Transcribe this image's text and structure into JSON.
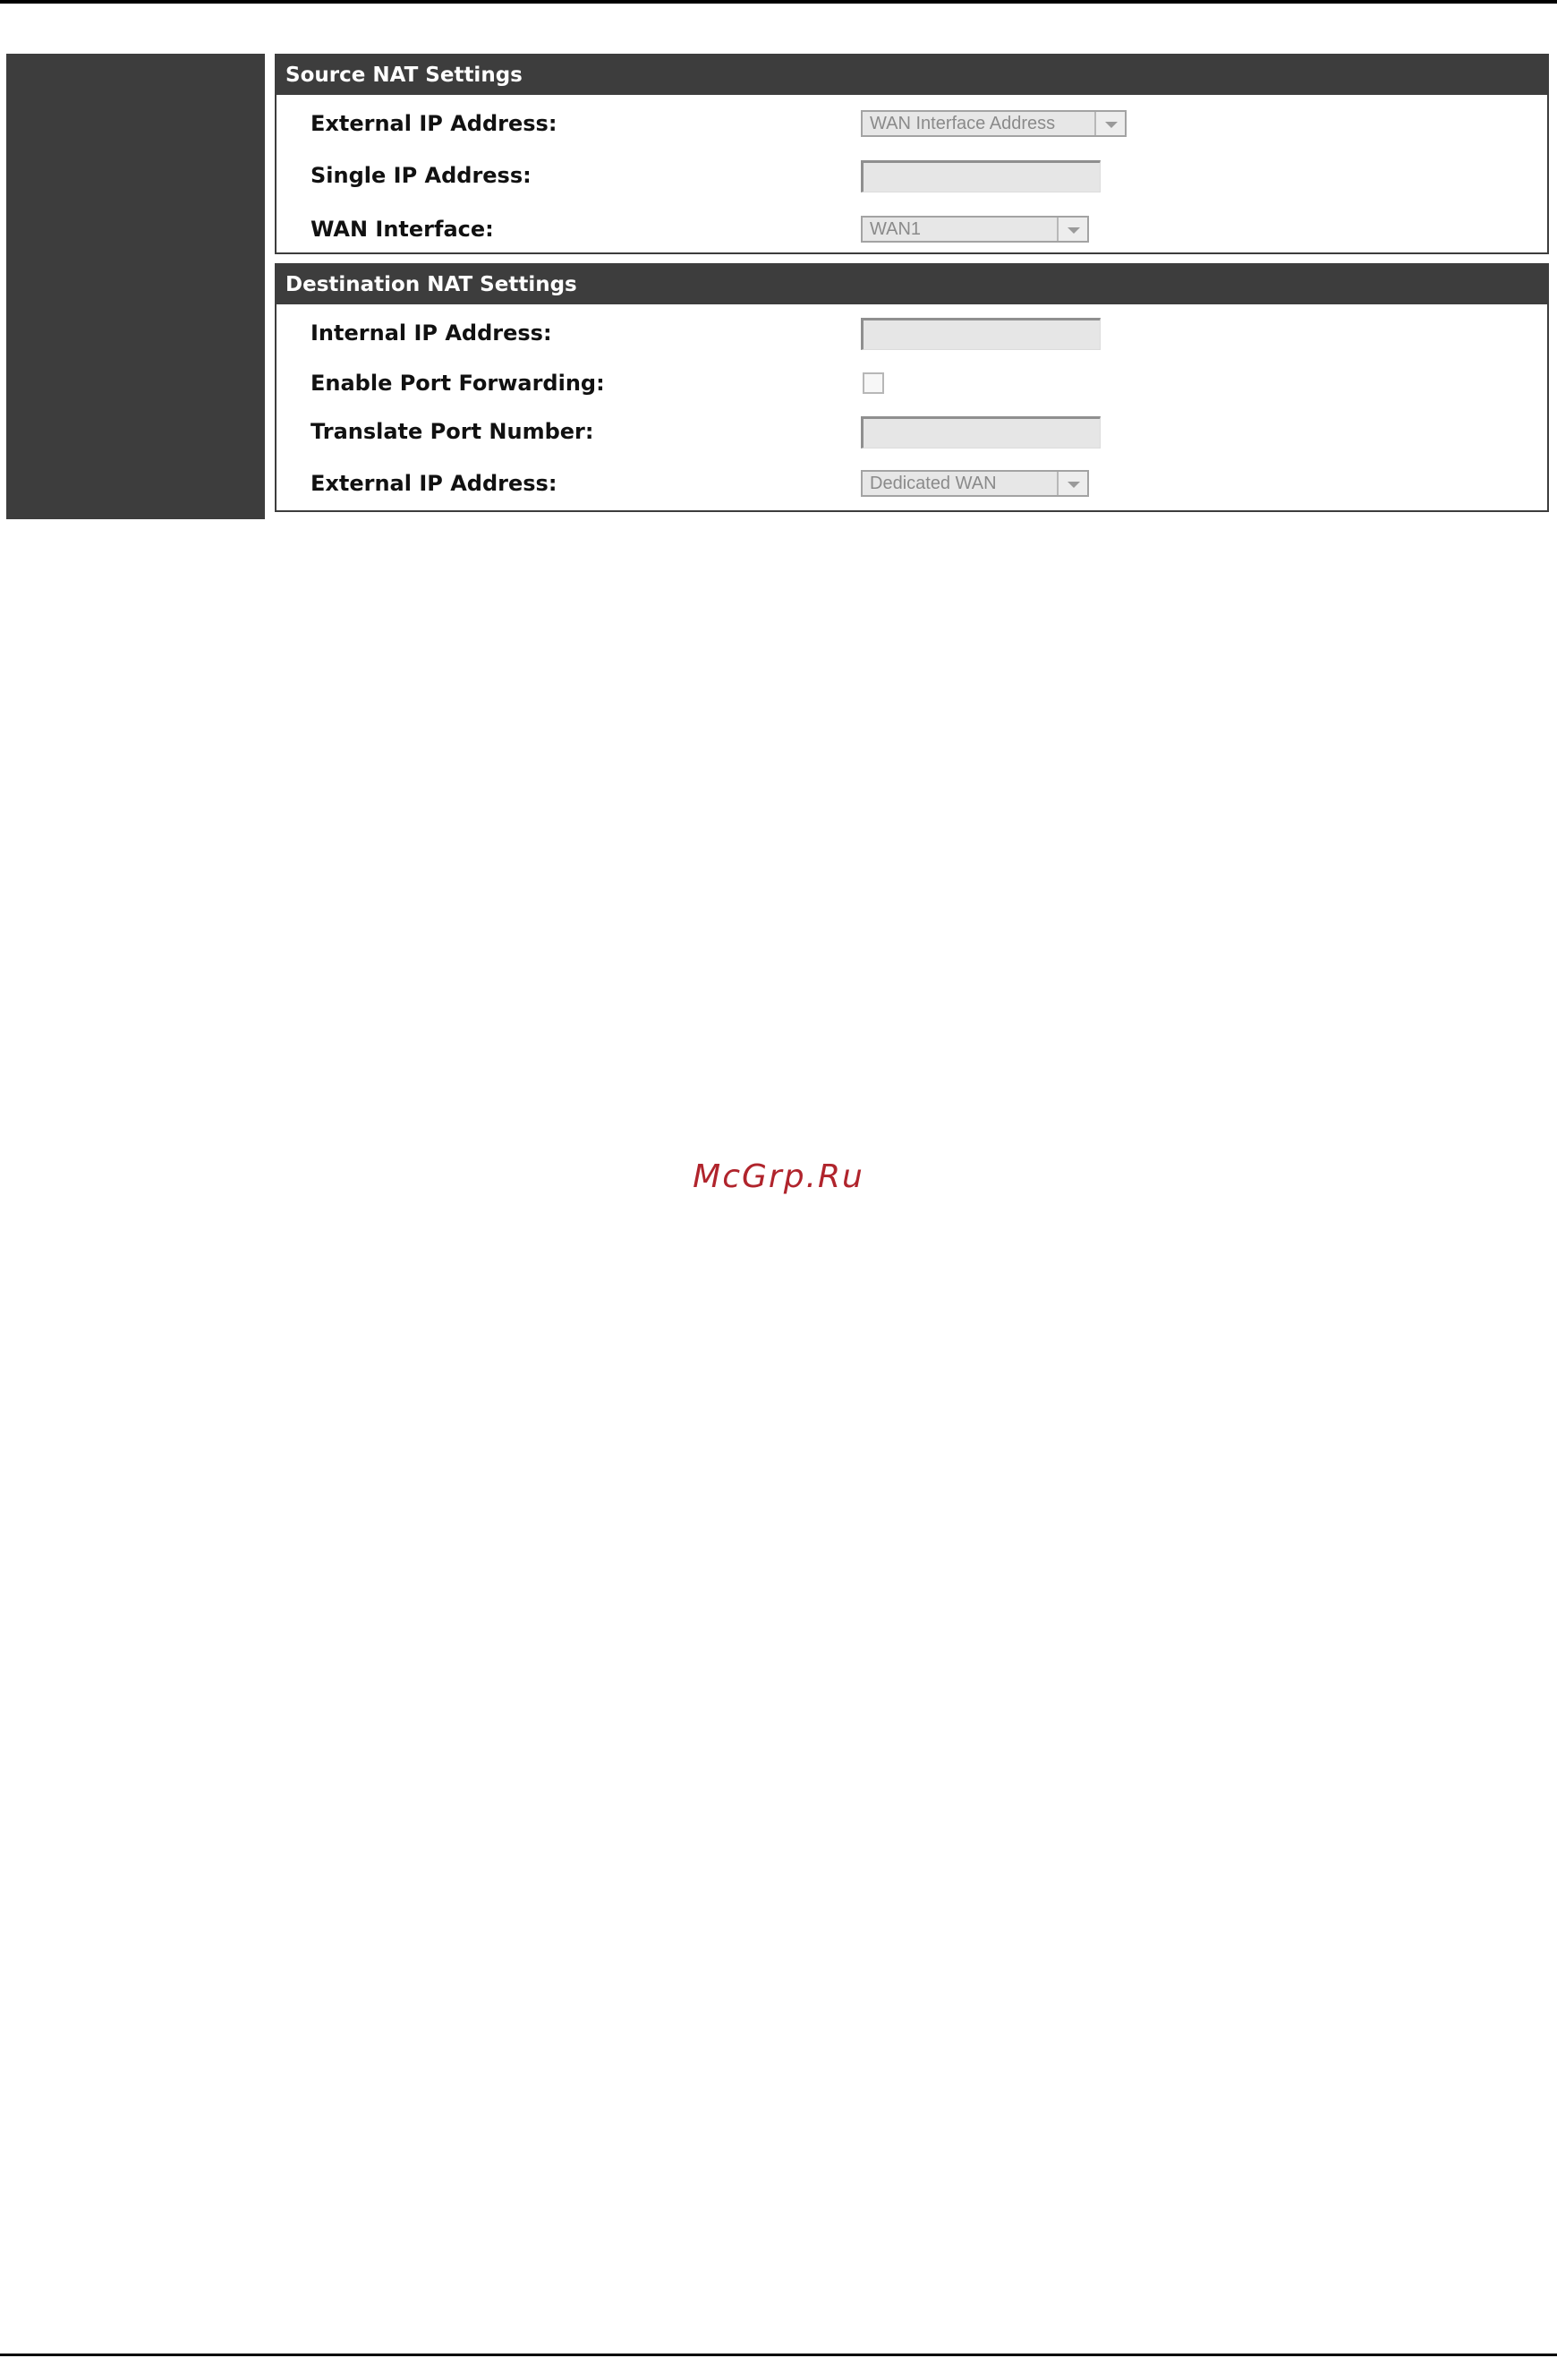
{
  "source_nat": {
    "title": "Source NAT Settings",
    "external_ip": {
      "label": "External IP Address:",
      "value": "WAN Interface Address"
    },
    "single_ip": {
      "label": "Single IP Address:",
      "value": ""
    },
    "wan_interface": {
      "label": "WAN Interface:",
      "value": "WAN1"
    }
  },
  "destination_nat": {
    "title": "Destination NAT Settings",
    "internal_ip": {
      "label": "Internal IP Address:",
      "value": ""
    },
    "port_forwarding": {
      "label": "Enable Port Forwarding:",
      "checked": false
    },
    "translate_port": {
      "label": "Translate Port Number:",
      "value": ""
    },
    "external_ip": {
      "label": "External IP Address:",
      "value": "Dedicated WAN"
    }
  },
  "watermark": "McGrp.Ru",
  "colors": {
    "header_bg": "#3d3d3d",
    "header_text": "#ffffff",
    "disabled_field_bg": "#e6e6e6",
    "disabled_text": "#8a8a8a",
    "watermark": "#b0242c"
  }
}
